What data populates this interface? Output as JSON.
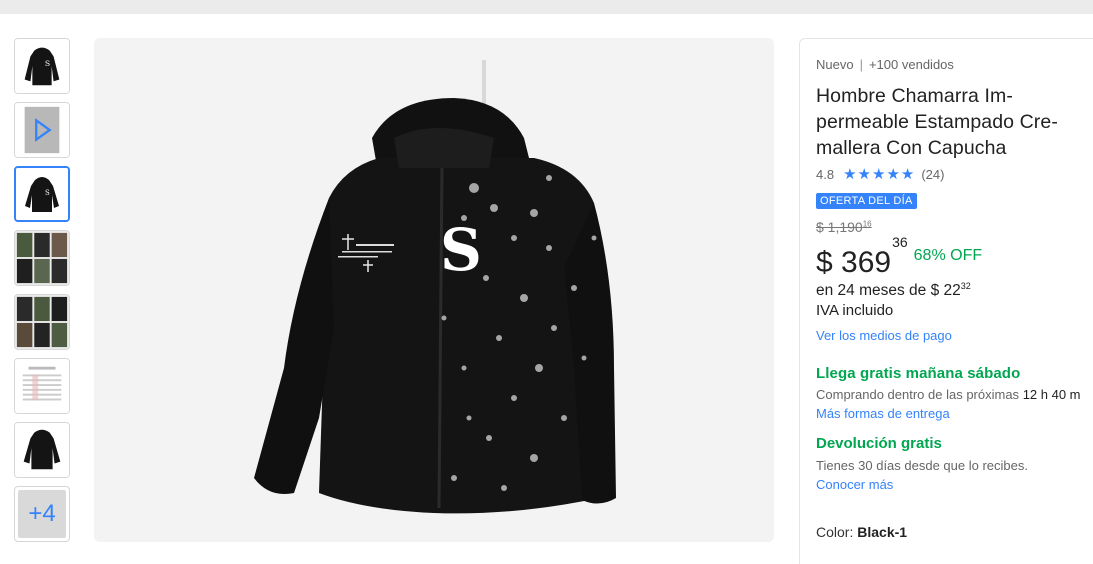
{
  "thumbnails": [
    {
      "type": "image",
      "icon": "jacket-front-icon"
    },
    {
      "type": "video",
      "icon": "play-icon"
    },
    {
      "type": "image",
      "icon": "jacket-front-icon",
      "selected": true
    },
    {
      "type": "image",
      "icon": "collage-icon"
    },
    {
      "type": "image",
      "icon": "collage-icon"
    },
    {
      "type": "image",
      "icon": "size-chart-icon"
    },
    {
      "type": "image",
      "icon": "jacket-back-icon"
    },
    {
      "type": "more",
      "label": "+4"
    }
  ],
  "main_image": {
    "jacket_print_letter": "S"
  },
  "product": {
    "condition": "Nuevo",
    "separator": "|",
    "sold": "+100 vendidos",
    "title": "Hombre Chamarra Im-permeable Estampado Cre-mallera Con Capucha",
    "rating_value": "4.8",
    "rating_stars": 5,
    "rating_count": "(24)",
    "deal_badge": "OFERTA DEL DÍA",
    "old_price": "$ 1,190",
    "old_price_cents": "16",
    "price": "$ 369",
    "price_cents": "36",
    "discount": "68% OFF",
    "installments_text": "en 24 meses de $ 22",
    "installments_cents": "32",
    "iva": "IVA incluido",
    "payment_link": "Ver los medios de pago"
  },
  "shipping": {
    "title": "Llega gratis mañana sábado",
    "subtitle": "Comprando dentro de las próximas",
    "countdown": "12 h 40 m",
    "link": "Más formas de entrega"
  },
  "returns": {
    "title": "Devolución gratis",
    "subtitle": "Tienes 30 días desde que lo recibes.",
    "link": "Conocer más"
  },
  "variant": {
    "label": "Color:",
    "value": "Black-1"
  },
  "colors": {
    "accent": "#3483fa",
    "green": "#00a650",
    "jacket": "#141414"
  }
}
